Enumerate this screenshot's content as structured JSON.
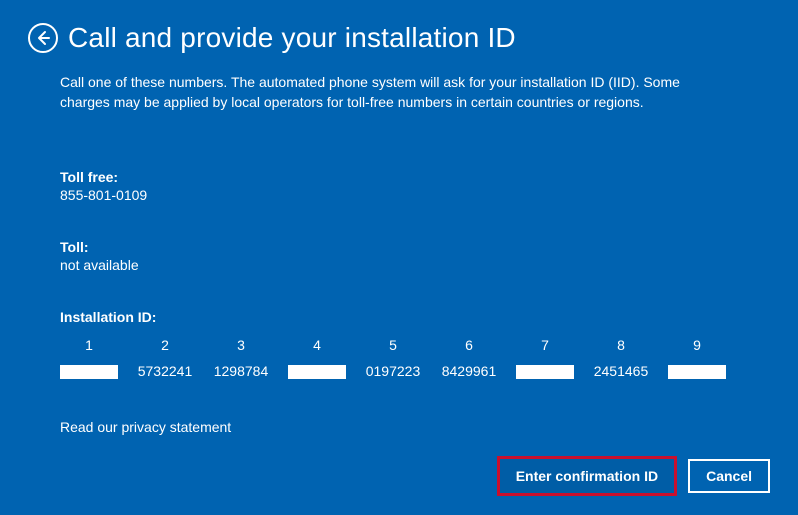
{
  "header": {
    "title": "Call and provide your installation ID"
  },
  "description": "Call one of these numbers. The automated phone system will ask for your installation ID (IID). Some charges may be applied by local operators for toll-free numbers in certain countries or regions.",
  "toll_free": {
    "label": "Toll free:",
    "value": "855-801-0109"
  },
  "toll": {
    "label": "Toll:",
    "value": "not available"
  },
  "installation_id": {
    "label": "Installation ID:",
    "columns": [
      {
        "n": "1",
        "v": "",
        "redacted": true
      },
      {
        "n": "2",
        "v": "5732241",
        "redacted": false
      },
      {
        "n": "3",
        "v": "1298784",
        "redacted": false
      },
      {
        "n": "4",
        "v": "",
        "redacted": true
      },
      {
        "n": "5",
        "v": "0197223",
        "redacted": false
      },
      {
        "n": "6",
        "v": "8429961",
        "redacted": false
      },
      {
        "n": "7",
        "v": "",
        "redacted": true
      },
      {
        "n": "8",
        "v": "2451465",
        "redacted": false
      },
      {
        "n": "9",
        "v": "",
        "redacted": true
      }
    ]
  },
  "privacy_link": "Read our privacy statement",
  "buttons": {
    "primary": "Enter confirmation ID",
    "cancel": "Cancel"
  }
}
